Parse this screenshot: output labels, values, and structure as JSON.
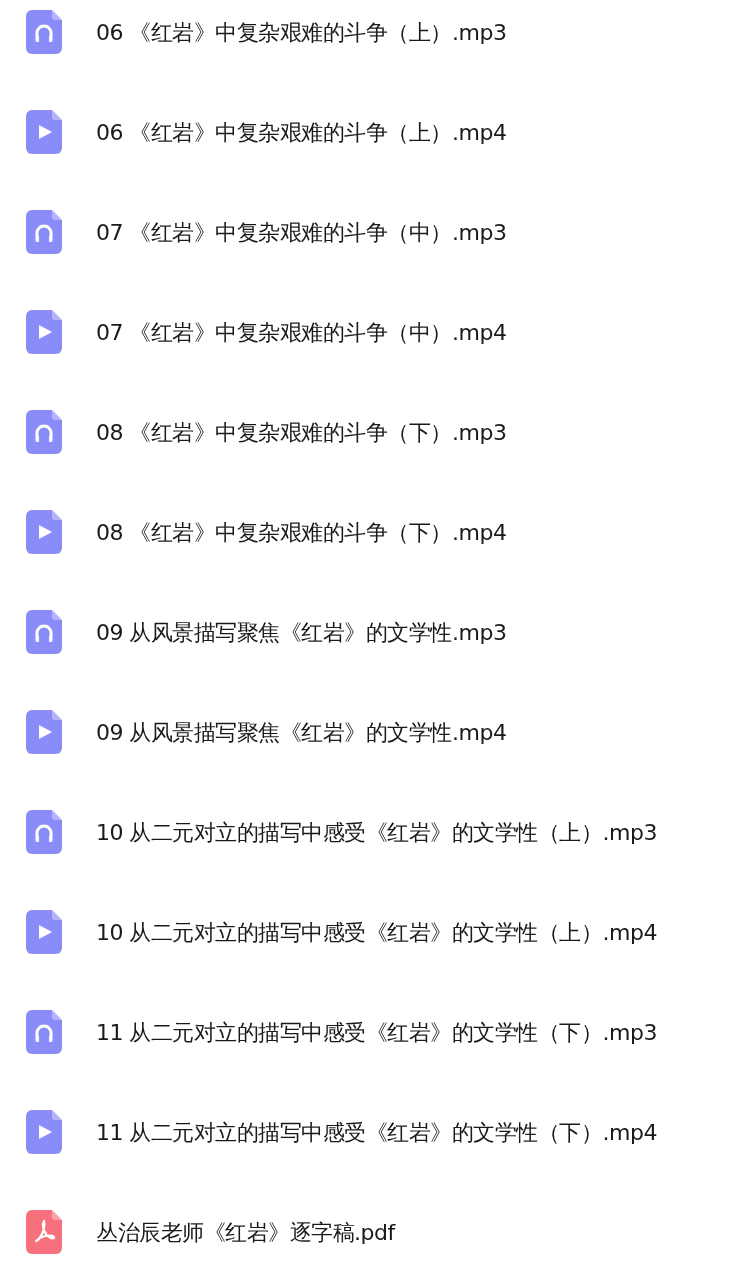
{
  "files": [
    {
      "kind": "audio",
      "name": "06 《红岩》中复杂艰难的斗争（上）.mp3"
    },
    {
      "kind": "video",
      "name": "06 《红岩》中复杂艰难的斗争（上）.mp4"
    },
    {
      "kind": "audio",
      "name": "07 《红岩》中复杂艰难的斗争（中）.mp3"
    },
    {
      "kind": "video",
      "name": "07 《红岩》中复杂艰难的斗争（中）.mp4"
    },
    {
      "kind": "audio",
      "name": "08 《红岩》中复杂艰难的斗争（下）.mp3"
    },
    {
      "kind": "video",
      "name": "08 《红岩》中复杂艰难的斗争（下）.mp4"
    },
    {
      "kind": "audio",
      "name": "09 从风景描写聚焦《红岩》的文学性.mp3"
    },
    {
      "kind": "video",
      "name": "09 从风景描写聚焦《红岩》的文学性.mp4"
    },
    {
      "kind": "audio",
      "name": "10 从二元对立的描写中感受《红岩》的文学性（上）.mp3"
    },
    {
      "kind": "video",
      "name": "10 从二元对立的描写中感受《红岩》的文学性（上）.mp4"
    },
    {
      "kind": "audio",
      "name": "11 从二元对立的描写中感受《红岩》的文学性（下）.mp3"
    },
    {
      "kind": "video",
      "name": "11 从二元对立的描写中感受《红岩》的文学性（下）.mp4"
    },
    {
      "kind": "pdf",
      "name": "丛治辰老师《红岩》逐字稿.pdf"
    }
  ]
}
